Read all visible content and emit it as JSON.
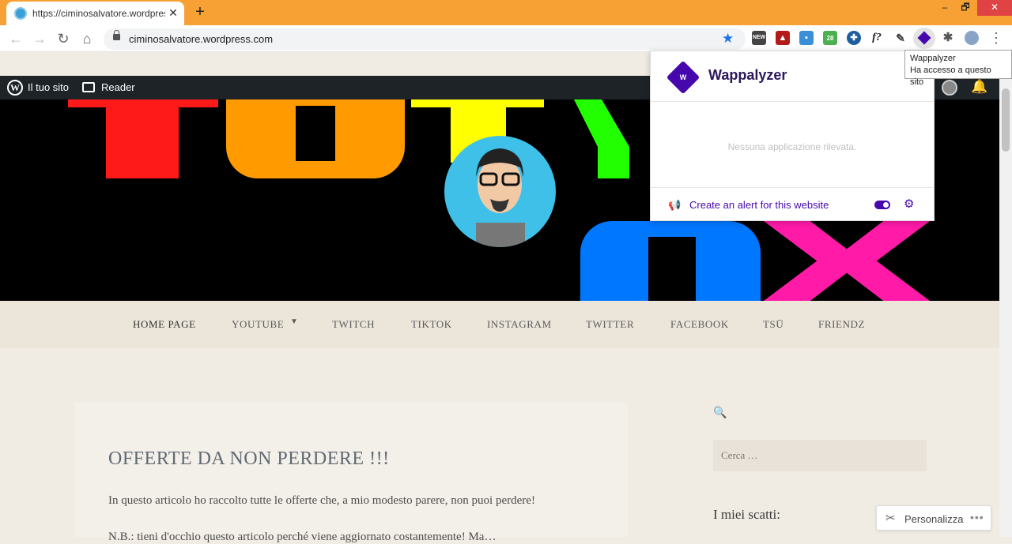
{
  "browser": {
    "tab_title": "https://ciminosalvatore.wordpress.com",
    "url": "ciminosalvatore.wordpress.com",
    "new_tab": "+",
    "tab_close": "✕",
    "minimize": "–",
    "restore": "🗗",
    "close": "✕",
    "extensions": [
      "news-extension",
      "pdf-extension",
      "screenshot-extension",
      "counter-extension",
      "globe-extension",
      "font-extension",
      "eyedropper-extension",
      "wappalyzer-extension",
      "puzzle-extension",
      "profile-avatar"
    ],
    "ext_badge": "28",
    "ext_font_label": "f?"
  },
  "tooltip": {
    "line1": "Wappalyzer",
    "line2": "Ha accesso a questo sito"
  },
  "adminbar": {
    "site_label": "Il tuo sito",
    "reader_label": "Reader"
  },
  "nav": {
    "items": [
      "HOME PAGE",
      "YOUTUBE",
      "TWITCH",
      "TIKTOK",
      "INSTAGRAM",
      "TWITTER",
      "FACEBOOK",
      "TSŪ",
      "FRIENDZ"
    ]
  },
  "post": {
    "title": "OFFERTE DA NON PERDERE !!!",
    "excerpt": "In questo articolo ho raccolto tutte le offerte che, a mio modesto parere, non puoi perdere!",
    "excerpt2": "N.B.: tieni d'occhio questo articolo perché viene aggiornato costantemente!  Ma…"
  },
  "sidebar": {
    "search_placeholder": "Cerca …",
    "widget_title": "I miei scatti:"
  },
  "customize": {
    "label": "Personalizza",
    "more": "•••"
  },
  "wappalyzer": {
    "brand": "Wappalyzer",
    "empty_message": "Nessuna applicazione rilevata.",
    "alert_label": "Create an alert for this website"
  },
  "colors": {
    "tab_bar": "#f7a034",
    "admin_bar": "#1d2327",
    "wappalyzer_purple": "#4608ad",
    "page_bg": "#f0ebe3"
  }
}
